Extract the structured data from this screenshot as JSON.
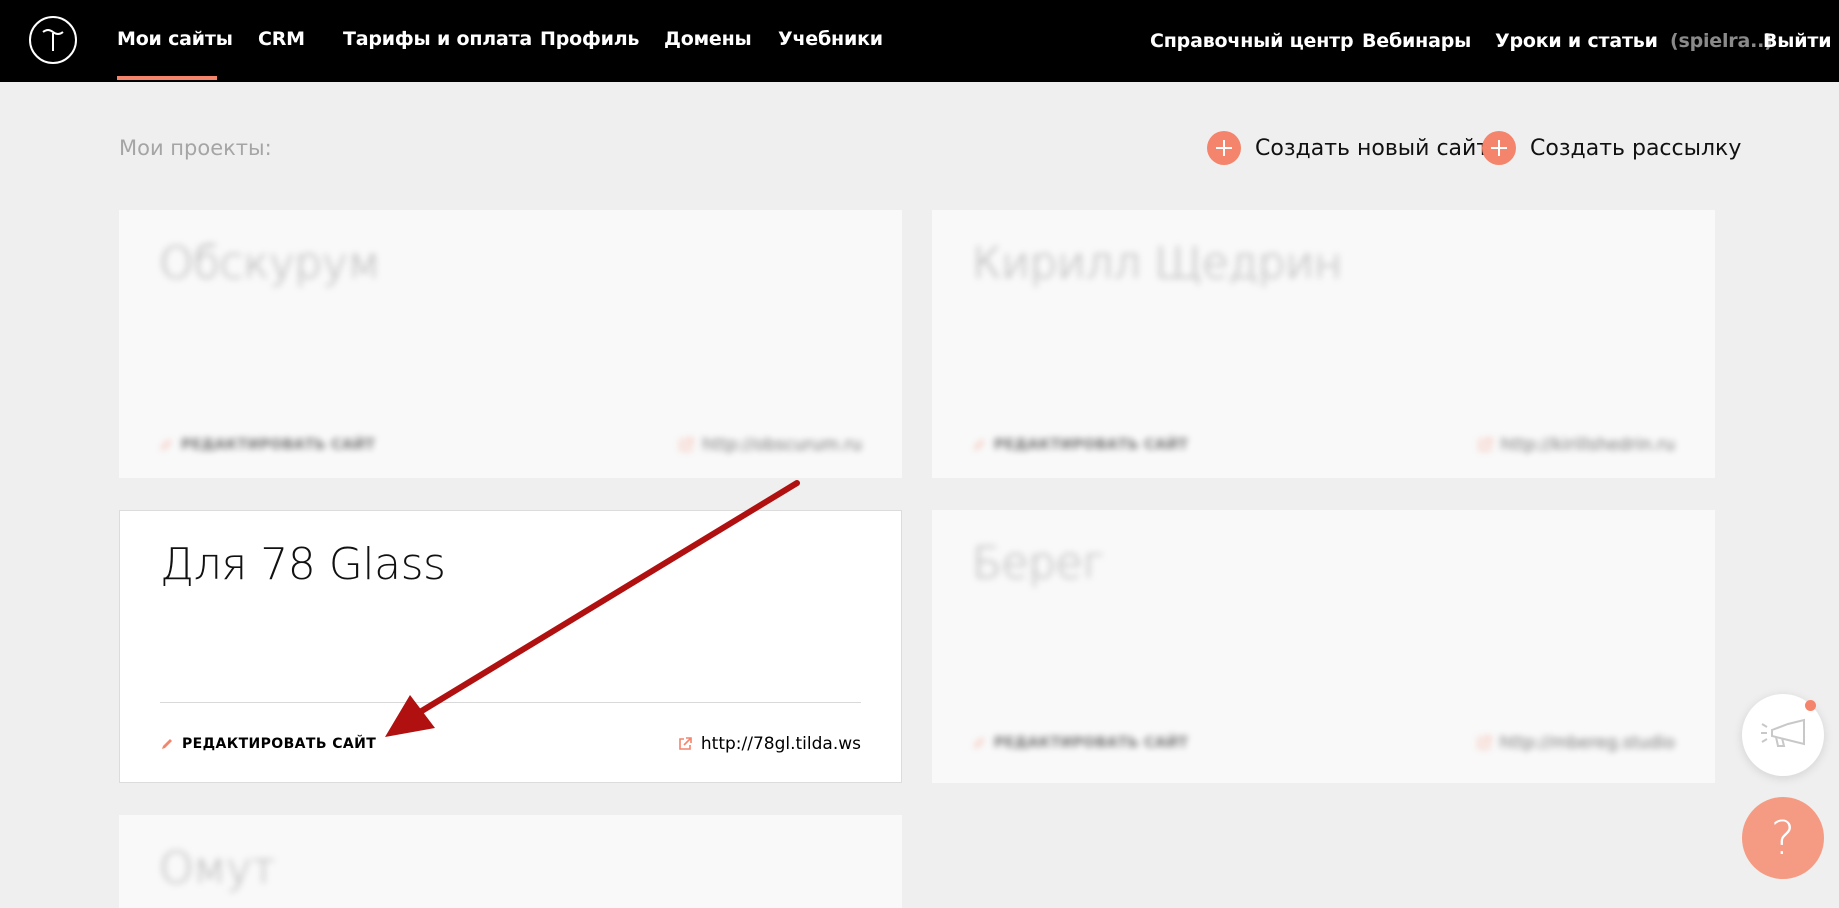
{
  "colors": {
    "accent": "#f4846b",
    "topbar": "#000000",
    "page_bg": "#efefef",
    "annotation": "#b01010"
  },
  "nav": {
    "logo_icon": "tilda-logo",
    "left_items": [
      {
        "label": "Мои сайты",
        "active": true
      },
      {
        "label": "CRM"
      },
      {
        "label": "Тарифы и оплата"
      },
      {
        "label": "Профиль"
      },
      {
        "label": "Домены"
      },
      {
        "label": "Учебники"
      }
    ],
    "right_items": [
      {
        "label": "Справочный центр"
      },
      {
        "label": "Вебинары"
      },
      {
        "label": "Уроки и статьи"
      }
    ],
    "user": "(spielra..)",
    "logout": "Выйти"
  },
  "header": {
    "projects_label": "Мои проекты:",
    "create_site": "Создать новый сайт",
    "create_mailing": "Создать рассылку"
  },
  "projects": [
    {
      "title": "Обскурум",
      "edit_label": "РЕДАКТИРОВАТЬ САЙТ",
      "url": "http://obscurum.ru",
      "blurred": true
    },
    {
      "title": "Кирилл Щедрин",
      "edit_label": "РЕДАКТИРОВАТЬ САЙТ",
      "url": "http://kirillshedrin.ru",
      "blurred": true
    },
    {
      "title": "Для 78 Glass",
      "edit_label": "РЕДАКТИРОВАТЬ САЙТ",
      "url": "http://78gl.tilda.ws",
      "blurred": false
    },
    {
      "title": "Берег",
      "edit_label": "РЕДАКТИРОВАТЬ САЙТ",
      "url": "http://mbereg.studio",
      "blurred": true
    },
    {
      "title": "Омут",
      "blurred": true
    }
  ],
  "floating": {
    "announce_icon": "megaphone-icon",
    "help_label": "?"
  }
}
